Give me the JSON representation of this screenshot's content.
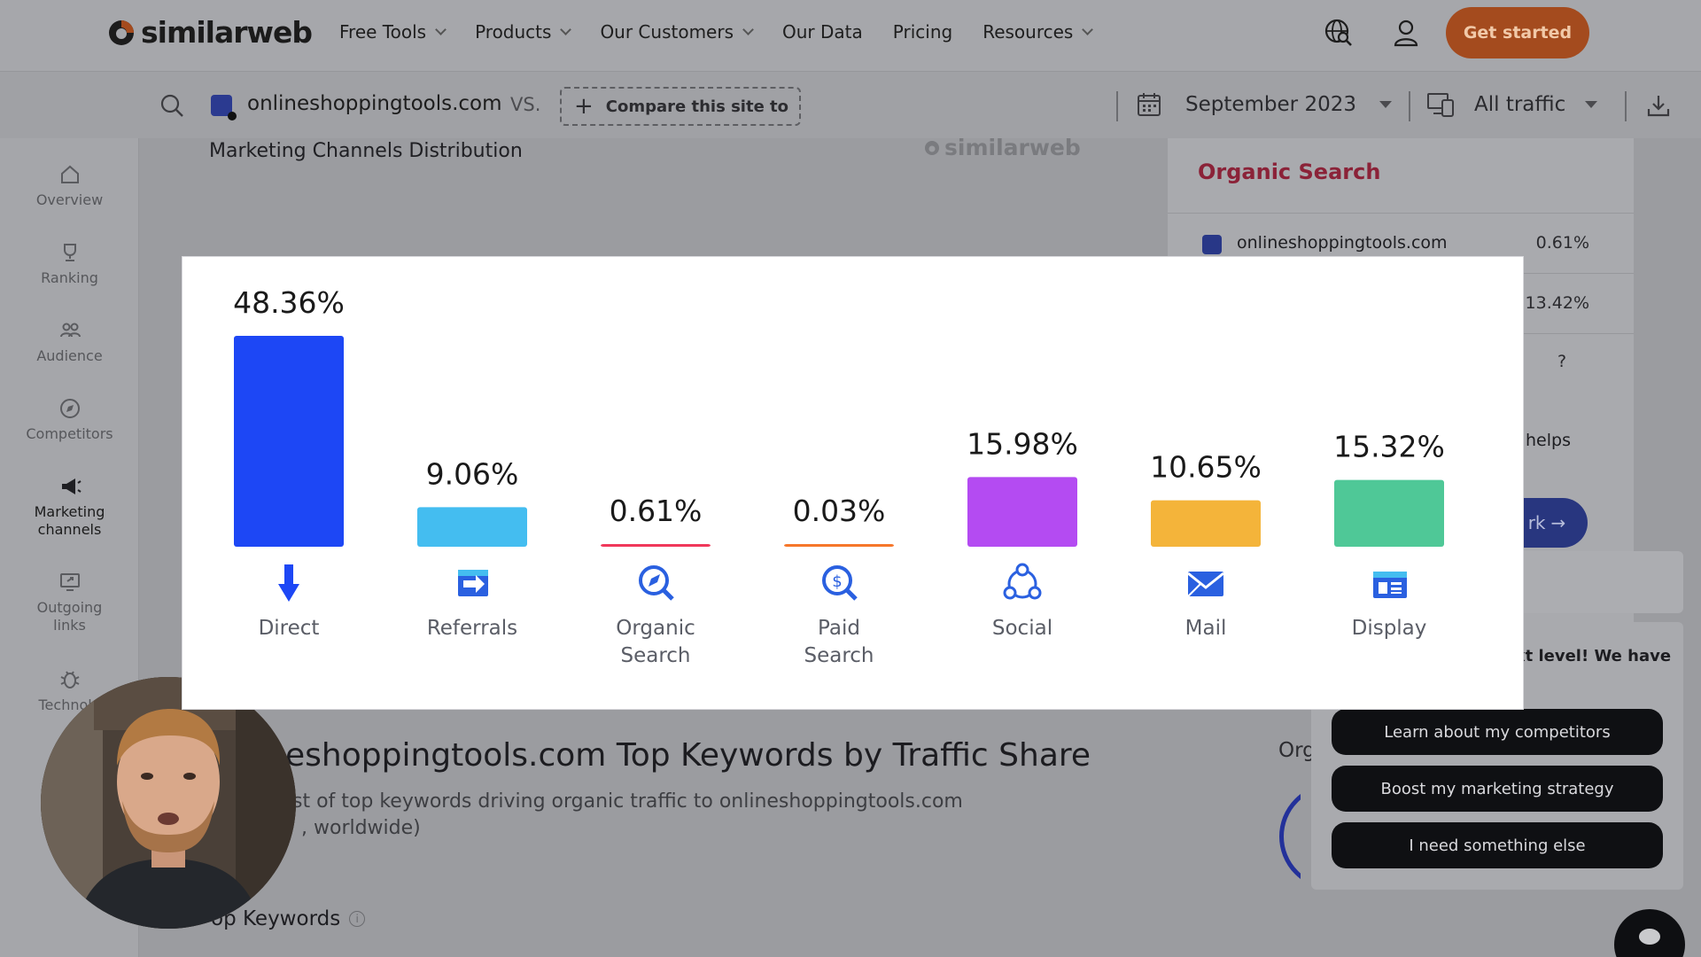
{
  "brand": {
    "name": "similarweb",
    "accent": "#1f4aff",
    "cta_color": "#b8541f"
  },
  "nav": {
    "items": [
      {
        "label": "Free Tools",
        "dropdown": true
      },
      {
        "label": "Products",
        "dropdown": true
      },
      {
        "label": "Our Customers",
        "dropdown": true
      },
      {
        "label": "Our Data",
        "dropdown": false
      },
      {
        "label": "Pricing",
        "dropdown": false
      },
      {
        "label": "Resources",
        "dropdown": true
      }
    ],
    "icons": [
      "globe-search-icon",
      "user-icon"
    ],
    "cta_label": "Get started"
  },
  "compare_bar": {
    "site": "onlineshoppingtools.com",
    "vs_label": "VS.",
    "compare_label": "Compare this site to",
    "date": "September 2023",
    "traffic": "All traffic"
  },
  "sidebar": {
    "items": [
      {
        "label": "Overview",
        "icon": "home-icon",
        "active": false
      },
      {
        "label": "Ranking",
        "icon": "trophy-icon",
        "active": false
      },
      {
        "label": "Audience",
        "icon": "people-icon",
        "active": false
      },
      {
        "label": "Competitors",
        "icon": "compass-icon",
        "active": false
      },
      {
        "label": "Marketing channels",
        "icon": "megaphone-icon",
        "active": true
      },
      {
        "label": "Outgoing links",
        "icon": "monitor-link-icon",
        "active": false
      },
      {
        "label": "Technolo",
        "icon": "bug-icon",
        "active": false
      }
    ]
  },
  "main": {
    "section_title": "Marketing Channels Distribution",
    "watermark": "similarweb",
    "keywords_title": "eshoppingtools.com Top Keywords by Traffic Share",
    "keywords_sub1": "st of top keywords driving organic traffic to onlineshoppingtools.com",
    "keywords_sub2": ", worldwide)",
    "top_keywords_label": "op Keywords",
    "organic_fragment": "Org"
  },
  "right_panel": {
    "title": "Organic Search",
    "rows": [
      {
        "site": "onlineshoppingtools.com",
        "value": "0.61%"
      },
      {
        "site": "",
        "value": "13.42%"
      },
      {
        "site": "",
        "value": "?"
      }
    ],
    "fragment_helps": "helps",
    "pill_text": "rk"
  },
  "chat": {
    "message_fragment": "xt level! We have",
    "options": [
      "Learn about my competitors",
      "Boost my marketing strategy",
      "I need something else"
    ]
  },
  "chart_data": {
    "type": "bar",
    "categories": [
      "Direct",
      "Referrals",
      "Organic Search",
      "Paid Search",
      "Social",
      "Mail",
      "Display"
    ],
    "category_lines": [
      [
        "Direct"
      ],
      [
        "Referrals"
      ],
      [
        "Organic",
        "Search"
      ],
      [
        "Paid",
        "Search"
      ],
      [
        "Social"
      ],
      [
        "Mail"
      ],
      [
        "Display"
      ]
    ],
    "values": [
      48.36,
      9.06,
      0.61,
      0.03,
      15.98,
      10.65,
      15.32
    ],
    "value_labels": [
      "48.36%",
      "9.06%",
      "0.61%",
      "0.03%",
      "15.98%",
      "10.65%",
      "15.32%"
    ],
    "colors": [
      "#1d47f5",
      "#44bdf0",
      "#f0385a",
      "#f6772b",
      "#b44bf2",
      "#f4b43a",
      "#4fc897"
    ],
    "icons": [
      "arrow-down-icon",
      "referral-arrow-icon",
      "organic-search-icon",
      "paid-search-icon",
      "social-icon",
      "mail-icon",
      "display-icon"
    ],
    "ylim": [
      0,
      50
    ],
    "grid": false
  }
}
